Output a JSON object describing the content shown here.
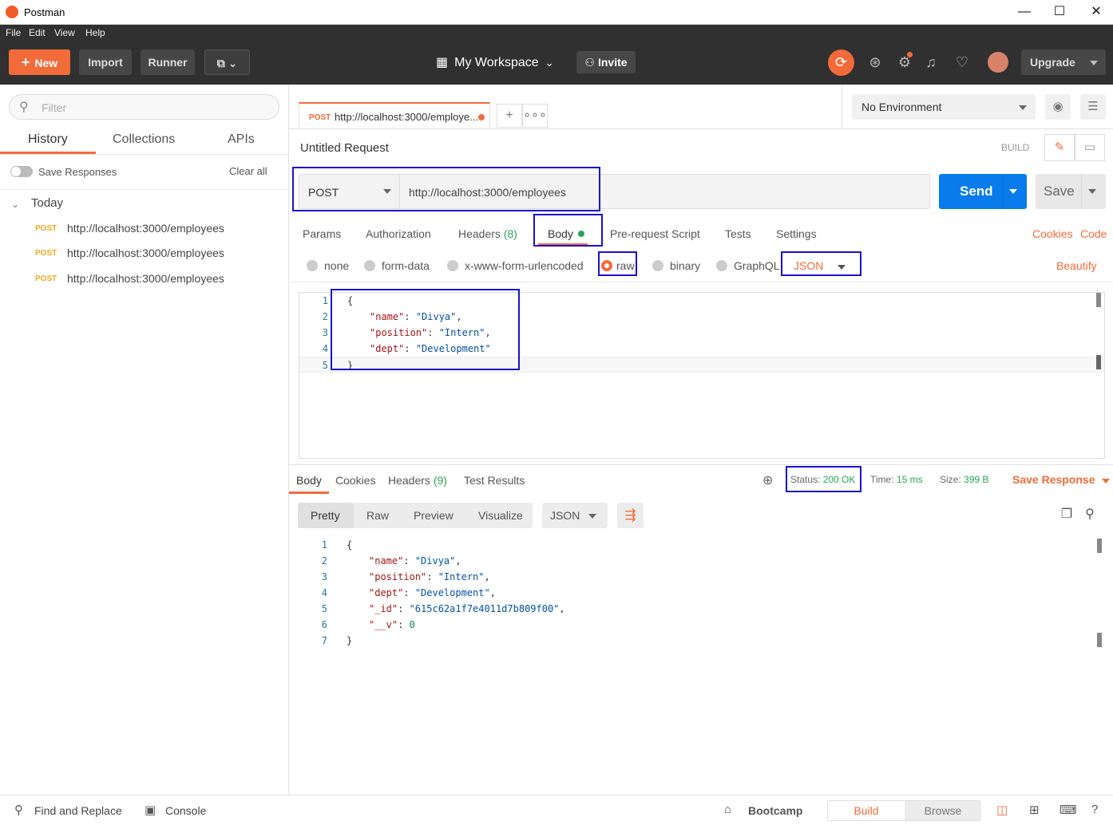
{
  "window": {
    "title": "Postman",
    "minimize": "—",
    "maximize": "☐",
    "close": "✕"
  },
  "menu": [
    "File",
    "Edit",
    "View",
    "Help"
  ],
  "header": {
    "new_label": "New",
    "new_icon": "+",
    "import_label": "Import",
    "runner_label": "Runner",
    "workspace_label": "My Workspace",
    "invite_label": "Invite",
    "upgrade_label": "Upgrade"
  },
  "sidebar": {
    "filter_placeholder": "Filter",
    "tabs": [
      "History",
      "Collections",
      "APIs"
    ],
    "save_responses": "Save Responses",
    "clear_all": "Clear all",
    "group_label": "Today",
    "history": [
      {
        "method": "POST",
        "url": "http://localhost:3000/employees"
      },
      {
        "method": "POST",
        "url": "http://localhost:3000/employees"
      },
      {
        "method": "POST",
        "url": "http://localhost:3000/employees"
      }
    ]
  },
  "request_tab": {
    "method": "POST",
    "url": "http://localhost:3000/employe..."
  },
  "environment": {
    "selected": "No Environment"
  },
  "request": {
    "title": "Untitled Request",
    "build_label": "BUILD",
    "method": "POST",
    "url": "http://localhost:3000/employees",
    "send_label": "Send",
    "save_label": "Save",
    "tabs": {
      "params": "Params",
      "authorization": "Authorization",
      "headers": "Headers",
      "headers_count": "(8)",
      "body": "Body",
      "prerequest": "Pre-request Script",
      "tests": "Tests",
      "settings": "Settings"
    },
    "cookies_link": "Cookies",
    "code_link": "Code",
    "body_modes": [
      "none",
      "form-data",
      "x-www-form-urlencoded",
      "raw",
      "binary",
      "GraphQL"
    ],
    "selected_body_mode": "raw",
    "language": "JSON",
    "beautify": "Beautify",
    "body_lines": [
      {
        "no": "1",
        "text": "{"
      },
      {
        "no": "2",
        "key": "\"name\"",
        "value": "\"Divya\"",
        "tail": ","
      },
      {
        "no": "3",
        "key": "\"position\"",
        "value": "\"Intern\"",
        "tail": ","
      },
      {
        "no": "4",
        "key": "\"dept\"",
        "value": "\"Development\"",
        "tail": ""
      },
      {
        "no": "5",
        "text": "}"
      }
    ]
  },
  "response": {
    "tabs": {
      "body": "Body",
      "cookies": "Cookies",
      "headers": "Headers",
      "headers_count": "(9)",
      "test_results": "Test Results"
    },
    "status_label": "Status:",
    "status_value": "200 OK",
    "time_label": "Time:",
    "time_value": "15 ms",
    "size_label": "Size:",
    "size_value": "399 B",
    "save_response": "Save Response",
    "view_modes": [
      "Pretty",
      "Raw",
      "Preview",
      "Visualize"
    ],
    "language": "JSON",
    "lines": [
      {
        "no": "1",
        "text": "{"
      },
      {
        "no": "2",
        "key": "\"name\"",
        "value": "\"Divya\"",
        "tail": ","
      },
      {
        "no": "3",
        "key": "\"position\"",
        "value": "\"Intern\"",
        "tail": ","
      },
      {
        "no": "4",
        "key": "\"dept\"",
        "value": "\"Development\"",
        "tail": ","
      },
      {
        "no": "5",
        "key": "\"_id\"",
        "value": "\"615c62a1f7e4011d7b809f00\"",
        "tail": ","
      },
      {
        "no": "6",
        "key": "\"__v\"",
        "num": "0",
        "tail": ""
      },
      {
        "no": "7",
        "text": "}"
      }
    ]
  },
  "footer": {
    "find_replace": "Find and Replace",
    "console": "Console",
    "bootcamp": "Bootcamp",
    "build": "Build",
    "browse": "Browse"
  },
  "colors": {
    "accent": "#f26b3a",
    "send": "#097bed",
    "header_bg": "#303030",
    "success": "#26a65b",
    "annotation": "#1b10cc"
  }
}
